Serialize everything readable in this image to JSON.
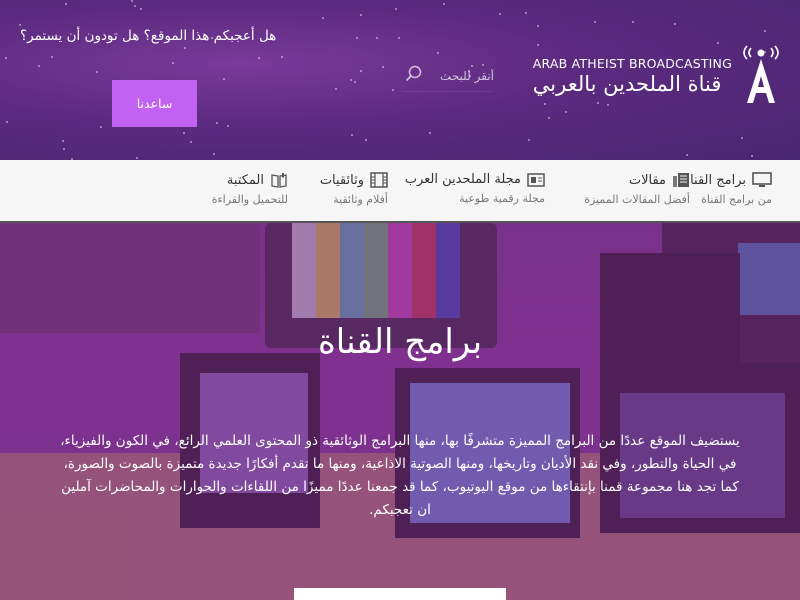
{
  "header": {
    "logo": {
      "english": "ARAB ATHEIST BROADCASTING",
      "arabic": "قناة الملحدين بالعربي",
      "icon": "broadcast-a-logo"
    },
    "search": {
      "placeholder": "أنقر للبحث",
      "icon": "search-icon"
    },
    "question": "هل أعجبكم هذا الموقع؟ هل تودون أن يستمر؟",
    "help_button": "ساعدنا"
  },
  "nav": {
    "items": [
      {
        "title": "برامج القناة",
        "subtitle": "من برامج القناة",
        "icon": "monitor-icon"
      },
      {
        "title": "مقالات",
        "subtitle": "أفضل المقالات المميزة",
        "icon": "document-icon"
      },
      {
        "title": "مجلة الملحدين العرب",
        "subtitle": "مجلة رقمية طوعية",
        "icon": "magazine-icon"
      },
      {
        "title": "وثائقيات",
        "subtitle": "أفلام وثائقية",
        "icon": "film-icon"
      },
      {
        "title": "المكتبة",
        "subtitle": "للتحميل والقراءة",
        "icon": "book-icon"
      }
    ]
  },
  "hero": {
    "title": "برامج القناة",
    "description": "يستضيف الموقع عددًا من البرامج المميزة متشرفًا بها، منها البرامج الوثائقية ذو المحتوى العلمي الرائع، في الكون والفيزياء، في الحياة والتطور، وفي نقد الأديان وتاريخها، ومنها الصوتية الاذاعية، ومنها ما تقدم أفكارًا جديدة متميزة بالصوت والصورة، كما تجد هنا مجموعة قمنا بإنتقاءها من موقع اليوتيوب، كما قد جمعنا عددًا مميزًا من اللقاءات والحوارات والمحاضرات آملين ان تعجبكم."
  },
  "colors": {
    "header_bg": "#5a2a7e",
    "accent_button": "#c162f2",
    "nav_bg": "#f6f6f6",
    "hero_overlay": "#7a2a8c"
  }
}
